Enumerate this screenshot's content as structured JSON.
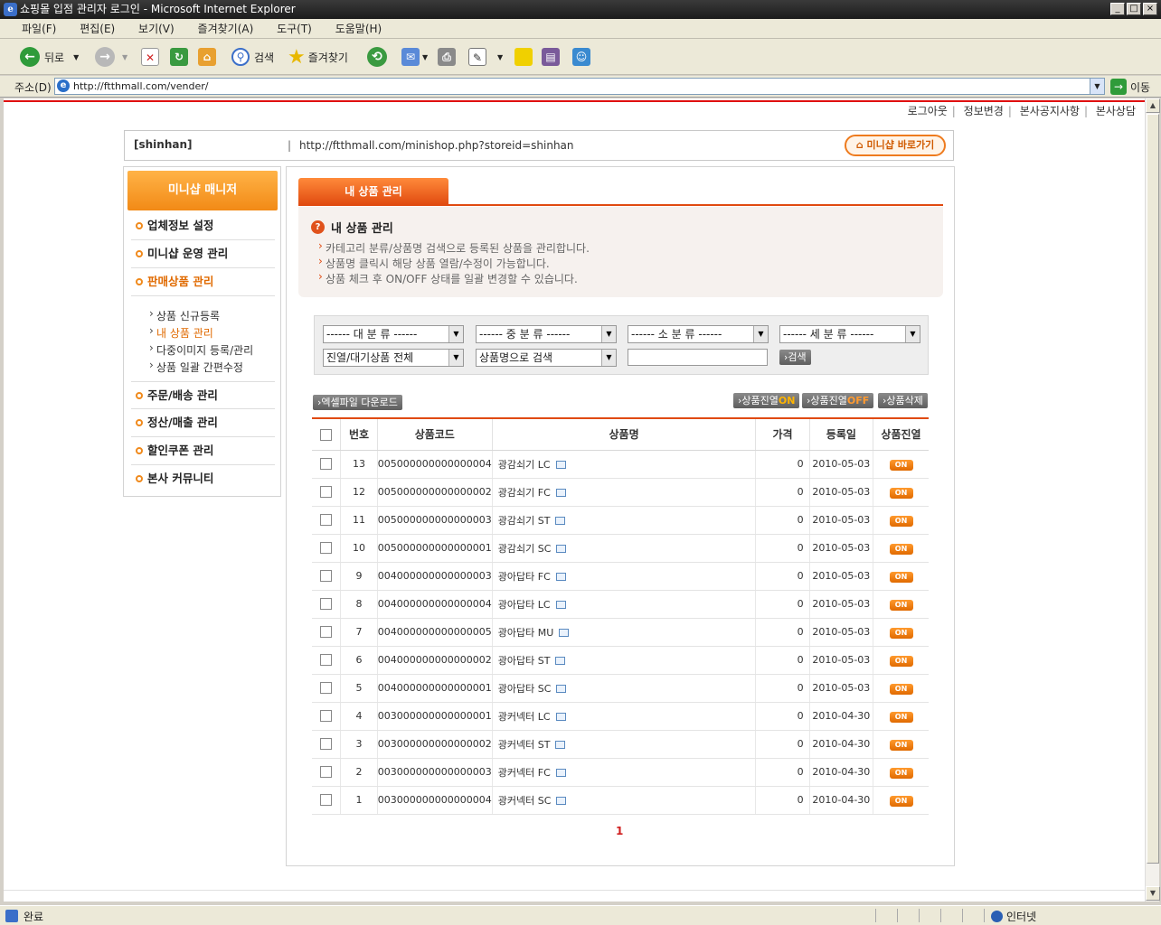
{
  "window": {
    "title": "쇼핑몰 입점 관리자 로그인 - Microsoft Internet Explorer"
  },
  "menubar": [
    "파일(F)",
    "편집(E)",
    "보기(V)",
    "즐겨찾기(A)",
    "도구(T)",
    "도움말(H)"
  ],
  "toolbar": {
    "back": "뒤로",
    "search": "검색",
    "favorites": "즐겨찾기"
  },
  "address": {
    "label": "주소(D)",
    "url": "http://ftthmall.com/vender/",
    "go": "이동"
  },
  "status": {
    "text": "완료",
    "zone": "인터넷"
  },
  "toplinks": [
    "로그아웃",
    "정보변경",
    "본사공지사항",
    "본사상담"
  ],
  "store": {
    "id": "[shinhan]",
    "separator": "|",
    "url": "http://ftthmall.com/minishop.php?storeid=shinhan",
    "button": "미니샵 바로가기"
  },
  "sidebar": {
    "header": "미니샵 매니저",
    "menu": [
      "업체정보 설정",
      "미니샵 운영 관리",
      "판매상품 관리"
    ],
    "submenu": [
      "상품 신규등록",
      "내 상품 관리",
      "다중이미지 등록/관리",
      "상품 일괄 간편수정"
    ],
    "menu2": [
      "주문/배송 관리",
      "정산/매출 관리",
      "할인쿠폰 관리",
      "본사 커뮤니티"
    ]
  },
  "main": {
    "tab": "내 상품 관리",
    "info_title": "내 상품 관리",
    "info_lines": [
      "카테고리 분류/상품명 검색으로 등록된 상품을 관리합니다.",
      "상품명 클릭시 해당 상품 열람/수정이 가능합니다.",
      "상품 체크 후 ON/OFF 상태를 일괄 변경할 수 있습니다."
    ]
  },
  "search": {
    "cat1": "------ 대 분 류 ------",
    "cat2": "------ 중 분 류 ------",
    "cat3": "------ 소 분 류 ------",
    "cat4": "------ 세 분 류 ------",
    "status": "진열/대기상품 전체",
    "field": "상품명으로 검색",
    "button": "검색"
  },
  "actions": {
    "excel": "엑셀파일 다운로드",
    "display_prefix": "상품진열",
    "on": "ON",
    "off": "OFF",
    "delete": "상품삭제"
  },
  "table": {
    "headers": [
      "번호",
      "상품코드",
      "상품명",
      "가격",
      "등록일",
      "상품진열"
    ],
    "rows": [
      {
        "no": "13",
        "code": "005000000000000004",
        "name": "광감쇠기 LC",
        "price": "0",
        "date": "2010-05-03",
        "status": "ON"
      },
      {
        "no": "12",
        "code": "005000000000000002",
        "name": "광감쇠기 FC",
        "price": "0",
        "date": "2010-05-03",
        "status": "ON"
      },
      {
        "no": "11",
        "code": "005000000000000003",
        "name": "광감쇠기 ST",
        "price": "0",
        "date": "2010-05-03",
        "status": "ON"
      },
      {
        "no": "10",
        "code": "005000000000000001",
        "name": "광감쇠기 SC",
        "price": "0",
        "date": "2010-05-03",
        "status": "ON"
      },
      {
        "no": "9",
        "code": "004000000000000003",
        "name": "광아답타 FC",
        "price": "0",
        "date": "2010-05-03",
        "status": "ON"
      },
      {
        "no": "8",
        "code": "004000000000000004",
        "name": "광아답타 LC",
        "price": "0",
        "date": "2010-05-03",
        "status": "ON"
      },
      {
        "no": "7",
        "code": "004000000000000005",
        "name": "광아답타 MU",
        "price": "0",
        "date": "2010-05-03",
        "status": "ON"
      },
      {
        "no": "6",
        "code": "004000000000000002",
        "name": "광아답타 ST",
        "price": "0",
        "date": "2010-05-03",
        "status": "ON"
      },
      {
        "no": "5",
        "code": "004000000000000001",
        "name": "광아답타 SC",
        "price": "0",
        "date": "2010-05-03",
        "status": "ON"
      },
      {
        "no": "4",
        "code": "003000000000000001",
        "name": "광커넥터 LC",
        "price": "0",
        "date": "2010-04-30",
        "status": "ON"
      },
      {
        "no": "3",
        "code": "003000000000000002",
        "name": "광커넥터 ST",
        "price": "0",
        "date": "2010-04-30",
        "status": "ON"
      },
      {
        "no": "2",
        "code": "003000000000000003",
        "name": "광커넥터 FC",
        "price": "0",
        "date": "2010-04-30",
        "status": "ON"
      },
      {
        "no": "1",
        "code": "003000000000000004",
        "name": "광커넥터 SC",
        "price": "0",
        "date": "2010-04-30",
        "status": "ON"
      }
    ]
  },
  "pager": {
    "current": "1"
  }
}
